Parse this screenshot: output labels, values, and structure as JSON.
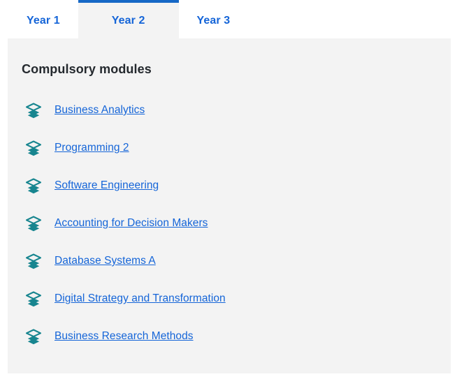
{
  "colors": {
    "accent_blue": "#1668c6",
    "link_blue": "#1565d8",
    "icon_teal": "#17858f",
    "panel_bg": "#f3f3f3",
    "heading_text": "#24292e",
    "page_bg": "#ffffff"
  },
  "tabs": [
    {
      "label": "Year 1",
      "active": false
    },
    {
      "label": "Year 2",
      "active": true
    },
    {
      "label": "Year 3",
      "active": false
    }
  ],
  "panel": {
    "heading": "Compulsory modules",
    "icon_name": "layers-icon",
    "modules": [
      {
        "label": "Business Analytics"
      },
      {
        "label": "Programming 2"
      },
      {
        "label": "Software Engineering"
      },
      {
        "label": "Accounting for Decision Makers"
      },
      {
        "label": "Database Systems A"
      },
      {
        "label": "Digital Strategy and Transformation"
      },
      {
        "label": "Business Research Methods"
      }
    ]
  }
}
